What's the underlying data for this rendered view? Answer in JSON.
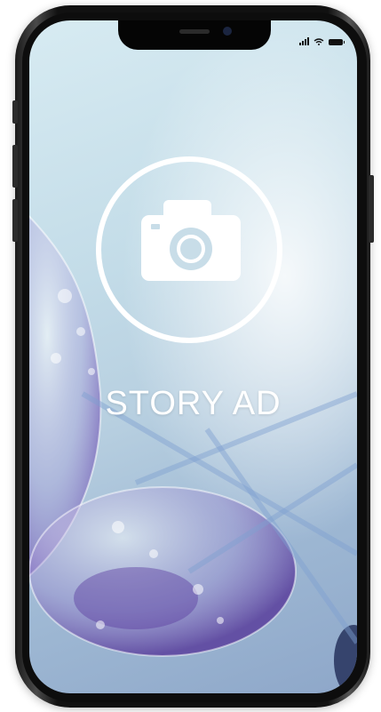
{
  "ad": {
    "headline": "STORY AD",
    "icon": "camera-icon"
  },
  "status_bar": {
    "icons": [
      "signal-icon",
      "wifi-icon",
      "battery-icon"
    ]
  },
  "colors": {
    "screen_background": "#c3dce8",
    "bubble_purple": "#8a72c2",
    "headline_text": "#ffffff"
  }
}
